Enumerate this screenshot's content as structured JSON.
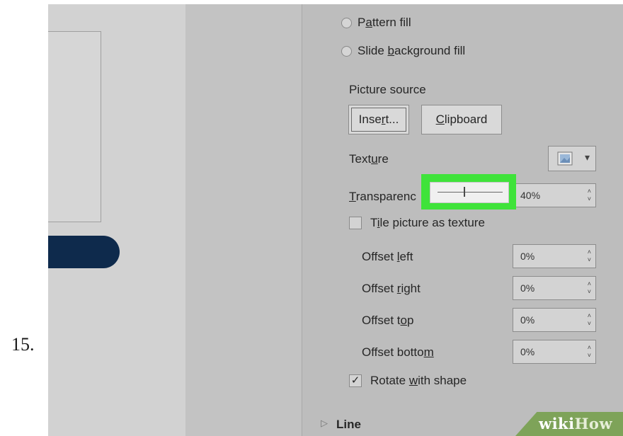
{
  "step_number": "15.",
  "panel": {
    "pattern_fill": {
      "before": "P",
      "underline": "a",
      "after": "ttern fill"
    },
    "slide_background_fill": {
      "before": "Slide ",
      "underline": "b",
      "after": "ackground fill"
    },
    "picture_source_label": "Picture source",
    "insert_button": {
      "before": "Inse",
      "underline": "r",
      "after": "t..."
    },
    "clipboard_button": {
      "before": "",
      "underline": "C",
      "after": "lipboard"
    },
    "texture": {
      "before": "Text",
      "underline": "u",
      "after": "re"
    },
    "transparency": {
      "before": "",
      "underline": "T",
      "after": "ransparenc",
      "value": "40%",
      "level": 0.4
    },
    "tile_picture": {
      "before": "T",
      "underline": "i",
      "after": "le picture as texture"
    },
    "offset_left": {
      "before": "Offset ",
      "underline": "l",
      "after": "eft",
      "value": "0%"
    },
    "offset_right": {
      "before": "Offset ",
      "underline": "r",
      "after": "ight",
      "value": "0%"
    },
    "offset_top": {
      "before": "Offset t",
      "underline": "o",
      "after": "p",
      "value": "0%"
    },
    "offset_bottom": {
      "before": "Offset botto",
      "underline": "m",
      "after": "",
      "value": "0%"
    },
    "rotate_with_shape": {
      "before": "Rotate ",
      "underline": "w",
      "after": "ith shape",
      "check": "✓"
    },
    "line_section": {
      "label": "Line",
      "arrow": "▷"
    }
  },
  "watermark": {
    "wiki": "wiki",
    "how": "How"
  },
  "icons": {
    "spin_up": "˄",
    "spin_down": "˅",
    "dropdown": "▾"
  }
}
